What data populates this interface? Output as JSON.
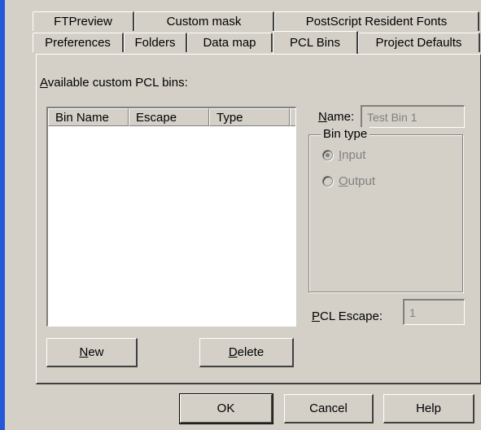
{
  "tabs_row1": [
    "FTPreview",
    "Custom mask",
    "PostScript Resident Fonts"
  ],
  "tabs_row2": [
    "Preferences",
    "Folders",
    "Data map",
    "PCL Bins",
    "Project Defaults"
  ],
  "active_tab": "PCL Bins",
  "pcl_bins": {
    "available_label_pre": "",
    "available_label_mnemonic": "A",
    "available_label_post": "vailable custom PCL bins:",
    "columns": [
      "Bin Name",
      "Escape",
      "Type"
    ],
    "rows": [],
    "name_label_mnemonic": "N",
    "name_label_post": "ame:",
    "name_value": "Test Bin 1",
    "bin_type": {
      "label": "Bin type",
      "options": [
        {
          "mnemonic": "I",
          "rest": "nput",
          "checked": true
        },
        {
          "mnemonic": "O",
          "rest": "utput",
          "checked": false
        }
      ]
    },
    "pcl_escape_mnemonic": "P",
    "pcl_escape_post": "CL Escape:",
    "pcl_escape_value": "1",
    "new_mnemonic": "N",
    "new_post": "ew",
    "delete_mnemonic": "D",
    "delete_post": "elete"
  },
  "footer": {
    "ok_label": "OK",
    "cancel_label": "Cancel",
    "help_label": "Help"
  },
  "colors": {
    "face": "#d4d0c8",
    "window_edge": "#2458d8",
    "disabled_text": "#808080"
  }
}
